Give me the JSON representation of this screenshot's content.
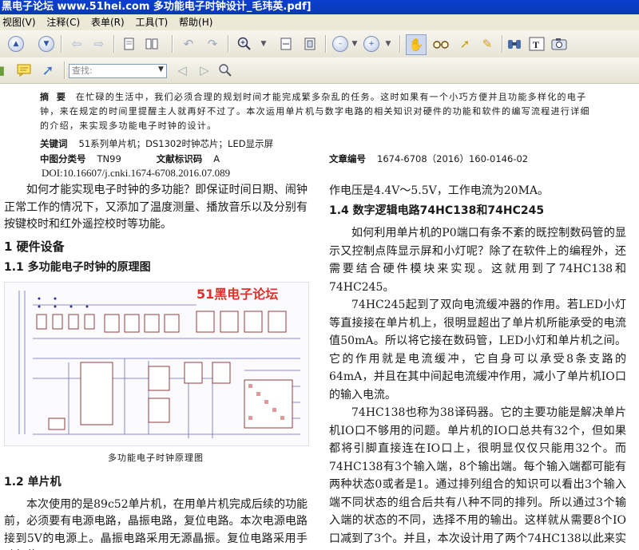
{
  "window": {
    "title": "黑电子论坛 www.51hei.com 多功能电子时钟设计_毛玮英.pdf]"
  },
  "menu": {
    "items": [
      "视图(V)",
      "注释(C)",
      "表单(R)",
      "工具(T)",
      "帮助(H)"
    ]
  },
  "toolbar": {
    "search_placeholder": "查找:",
    "icons": [
      "up-arrow",
      "down-arrow",
      "back-arrow",
      "forward-arrow",
      "page-view",
      "page-layout",
      "undo",
      "redo",
      "zoom-in",
      "fit-width",
      "fit-page",
      "zoom-out",
      "zoom-in-plus",
      "hand",
      "glasses",
      "select-arrow",
      "highlighter",
      "binoculars",
      "text-select",
      "snapshot",
      "note",
      "arrow-annotation",
      "prev-search",
      "next-search",
      "find"
    ]
  },
  "doc": {
    "abstract_label": "摘 要",
    "abstract_text": "在忙碌的生活中，我们必须合理的规划时间才能完成繁多杂乱的任务。这时如果有一个小巧方便并且功能多样化的电子钟，来在规定的时间里提醒主人就再好不过了。本次运用单片机与数字电路的相关知识对硬件的功能和软件的编写流程进行详细的介绍，来实现多功能电子时钟的设计。",
    "keywords_label": "关键词",
    "keywords_text": "51系列单片机；DS1302时钟芯片；LED显示屏",
    "clc_label": "中图分类号",
    "clc_value": "TN99",
    "doc_code_label": "文献标识码",
    "doc_code_value": "A",
    "article_no_label": "文章编号",
    "article_no_value": "1674-6708（2016）160-0146-02",
    "doi": "DOI:10.16607/j.cnki.1674-6708.2016.07.089",
    "left_intro": "如何才能实现电子时钟的多功能？即保证时间日期、闹钟正常工作的情况下，又添加了温度测量、播放音乐以及分别有按键校时和红外遥控校时等功能。",
    "heading_1": "1 硬件设备",
    "heading_1_1": "1.1 多功能电子时钟的原理图",
    "watermark": "51黑电子论坛",
    "figure_caption": "多功能电子时钟原理图",
    "heading_1_2": "1.2 单片机",
    "mcu_text": "本次使用的是89c52单片机，在用单片机完成后续的功能前，必须要有电源电路，晶振电路，复位电路。本次电源电路接到5V的电源上。晶振电路采用无源晶振。复位电路采用手动复位。",
    "right_top": "作电压是4.4V～5.5V，工作电流为20MA。",
    "heading_1_4": "1.4 数字逻辑电路74HC138和74HC245",
    "right_p1": "如何利用单片机的P0端口有条不紊的既控制数码管的显示又控制点阵显示屏和小灯呢？除了在软件上的编程外，还需要结合硬件模块来实现。这就用到了74HC138和74HC245。",
    "right_p2": "74HC245起到了双向电流缓冲器的作用。若LED小灯等直接接在单片机上，很明显超出了单片机所能承受的电流值50mA。所以将它接在数码管，LED小灯和单片机之间。它的作用就是电流缓冲，它自身可以承受8条支路的64mA，并且在其中间起电流缓冲作用，减小了单片机IO口的输入电流。",
    "right_p3": "74HC138也称为38译码器。它的主要功能是解决单片机IO口不够用的问题。单片机的IO口总共有32个，但如果都将引脚直接连在IO口上，很明显仅仅只能用32个。而74HC138有3个输入端，8个输出端。每个输入端都可能有两种状态0或者是1。通过排列组合的知识可以看出3个输入端不同状态的组合后共有八种不同的排列。所以通过3个输入端的状态的不同，选择不用的输出。这样就从需要8个IO口减到了3个。并且，本次设计用了两个74HC138以此来实现对不同显示器件的控制。"
  }
}
